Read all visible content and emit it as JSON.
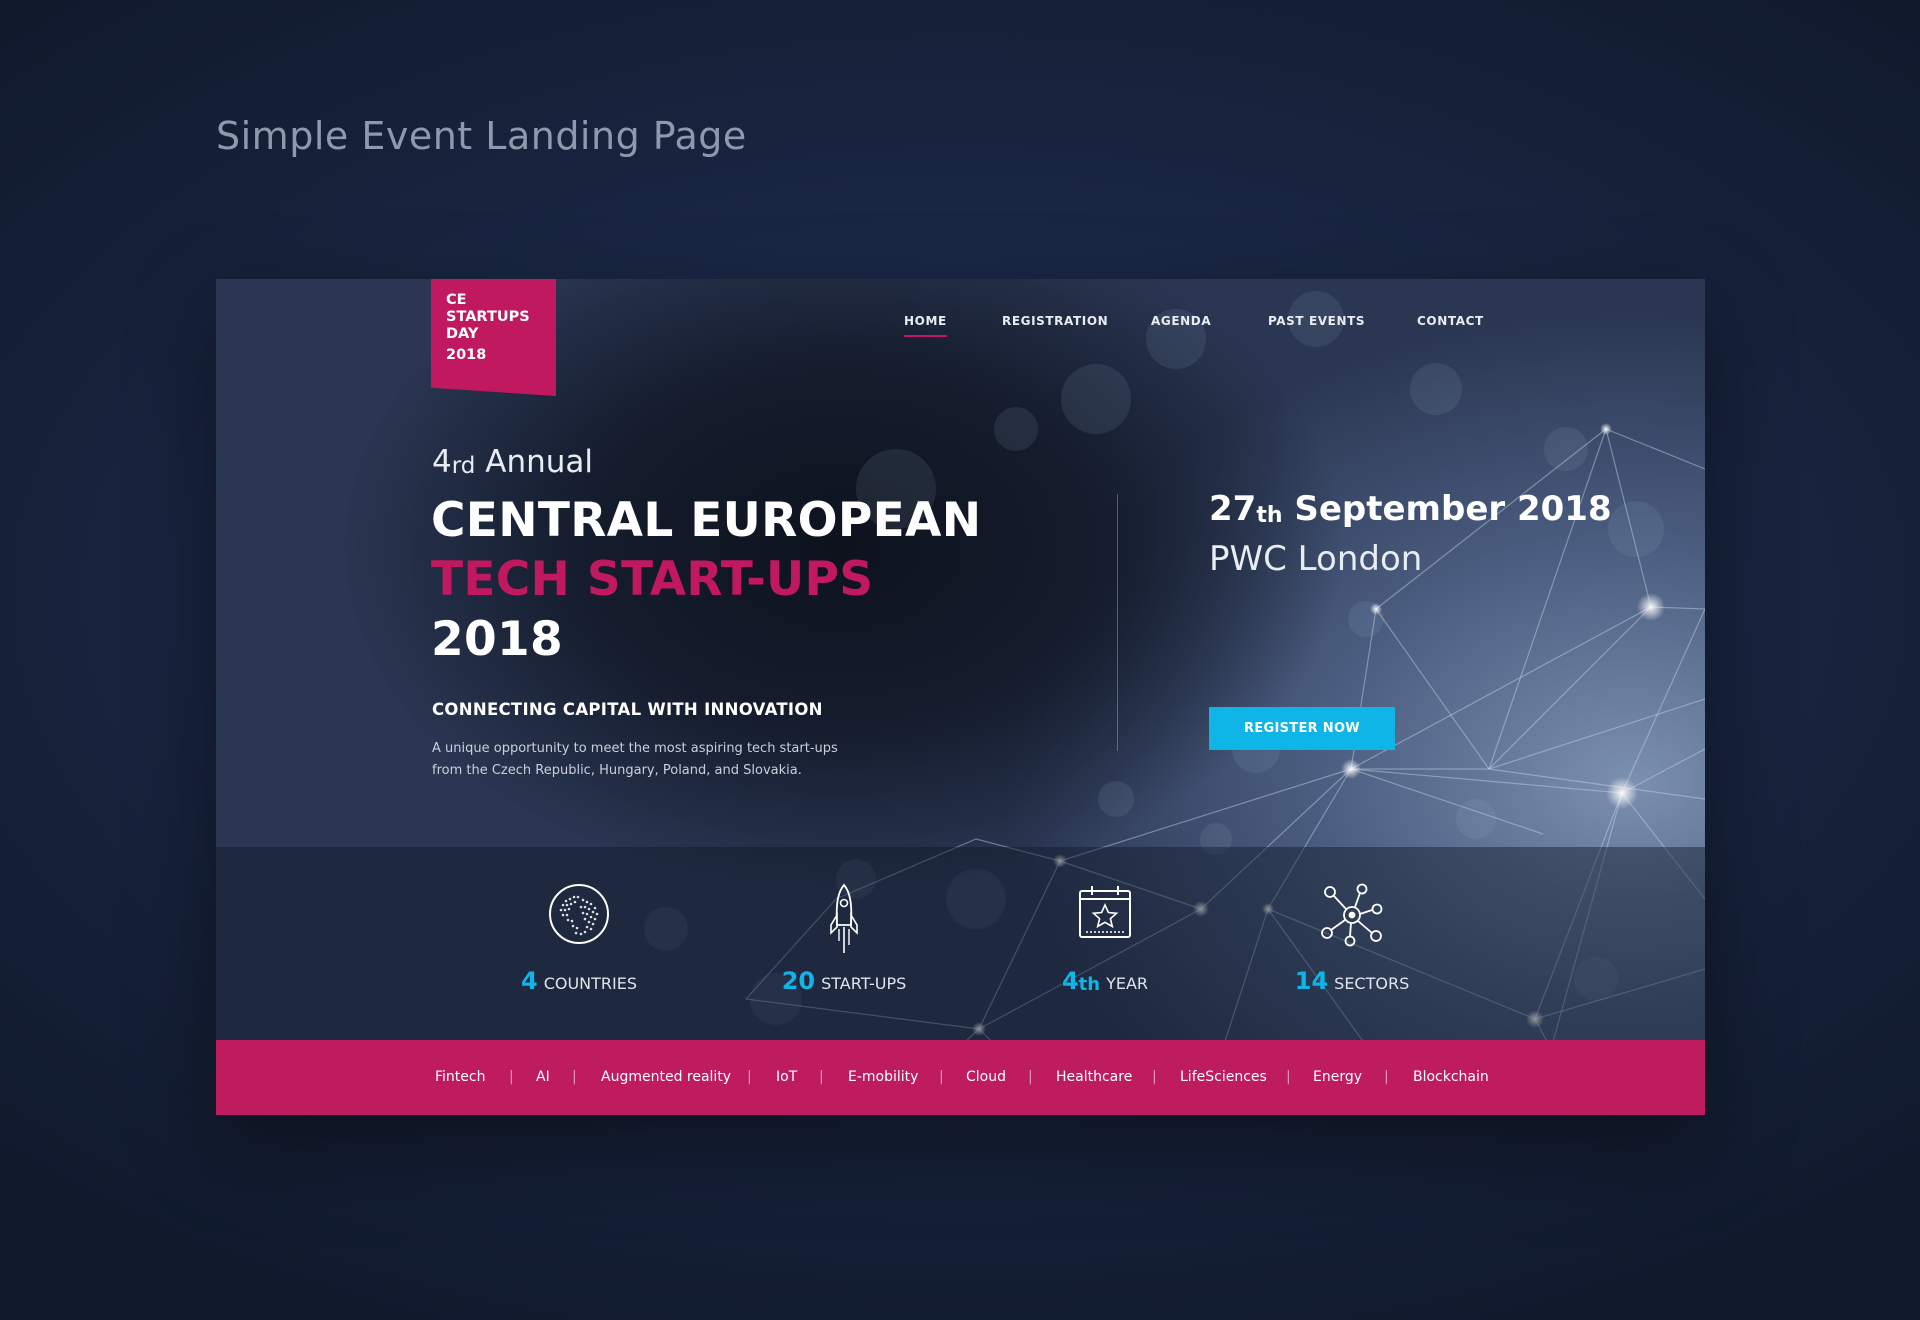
{
  "page": {
    "title": "Simple Event Landing Page"
  },
  "logo": {
    "line1": "CE",
    "line2": "STARTUPS",
    "line3": "DAY",
    "year": "2018"
  },
  "nav": {
    "items": [
      {
        "label": "HOME",
        "active": true
      },
      {
        "label": "REGISTRATION"
      },
      {
        "label": "AGENDA"
      },
      {
        "label": "PAST EVENTS"
      },
      {
        "label": "CONTACT"
      }
    ]
  },
  "hero": {
    "annual_number": "4",
    "annual_suffix": "rd",
    "annual_word": "Annual",
    "line1": "CENTRAL EUROPEAN",
    "line2": "TECH START-UPS",
    "line3": "2018",
    "tagline": "CONNECTING CAPITAL WITH INNOVATION",
    "description_line1": "A unique opportunity to meet the most aspiring tech start-ups",
    "description_line2": "from the Czech Republic, Hungary, Poland, and Slovakia."
  },
  "event": {
    "day": "27",
    "day_suffix": "th",
    "month_year": "September 2018",
    "venue": "PWC London",
    "register_label": "REGISTER NOW"
  },
  "stats": [
    {
      "number": "4",
      "suffix": "",
      "label": "COUNTRIES",
      "icon": "globe-icon"
    },
    {
      "number": "20",
      "suffix": "",
      "label": "START-UPS",
      "icon": "rocket-icon"
    },
    {
      "number": "4",
      "suffix": "th",
      "label": "YEAR",
      "icon": "calendar-star-icon"
    },
    {
      "number": "14",
      "suffix": "",
      "label": "SECTORS",
      "icon": "network-icon"
    }
  ],
  "sectors": [
    "Fintech",
    "AI",
    "Augmented reality",
    "IoT",
    "E-mobility",
    "Cloud",
    "Healthcare",
    "LifeSciences",
    "Energy",
    "Blockchain"
  ],
  "colors": {
    "brand_pink": "#c0195f",
    "accent_cyan": "#0fb5e6",
    "background_navy": "#1a2744"
  }
}
